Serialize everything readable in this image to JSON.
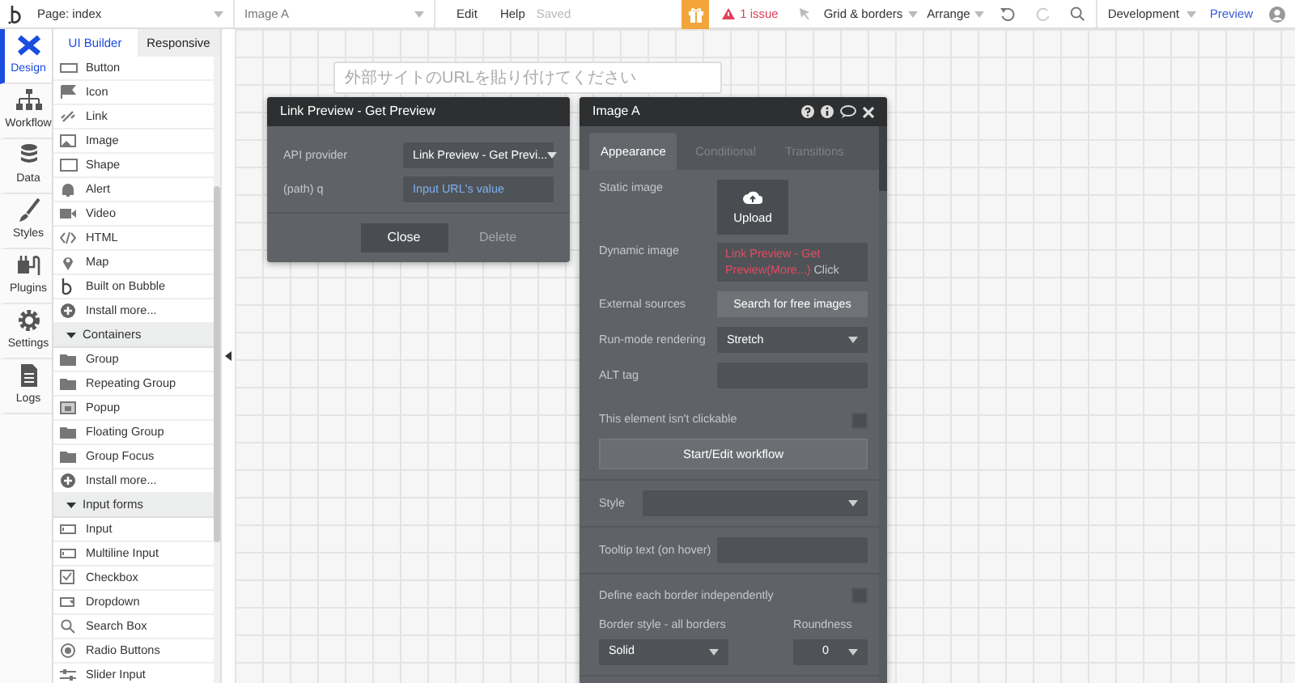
{
  "top_bar": {
    "page_select": "Page: index",
    "element_select": "Image A",
    "menu": [
      "Edit",
      "Help"
    ],
    "save_status": "Saved",
    "issues": "1 issue",
    "grid_menu": "Grid & borders",
    "arrange_menu": "Arrange",
    "mode_select": "Development",
    "preview": "Preview"
  },
  "nav_rail": [
    {
      "label": "Design",
      "selected": true
    },
    {
      "label": "Workflow",
      "selected": false
    },
    {
      "label": "Data",
      "selected": false
    },
    {
      "label": "Styles",
      "selected": false
    },
    {
      "label": "Plugins",
      "selected": false
    },
    {
      "label": "Settings",
      "selected": false
    },
    {
      "label": "Logs",
      "selected": false
    }
  ],
  "palette": {
    "tabs": [
      {
        "label": "UI Builder",
        "selected": true
      },
      {
        "label": "Responsive",
        "selected": false
      }
    ],
    "items": [
      {
        "kind": "item",
        "label": "Button"
      },
      {
        "kind": "item",
        "label": "Icon"
      },
      {
        "kind": "item",
        "label": "Link"
      },
      {
        "kind": "item",
        "label": "Image"
      },
      {
        "kind": "item",
        "label": "Shape"
      },
      {
        "kind": "item",
        "label": "Alert"
      },
      {
        "kind": "item",
        "label": "Video"
      },
      {
        "kind": "item",
        "label": "HTML"
      },
      {
        "kind": "item",
        "label": "Map"
      },
      {
        "kind": "item",
        "label": "Built on Bubble"
      },
      {
        "kind": "item",
        "label": "Install more..."
      },
      {
        "kind": "section",
        "label": "Containers",
        "expanded": true
      },
      {
        "kind": "item",
        "label": "Group"
      },
      {
        "kind": "item",
        "label": "Repeating Group"
      },
      {
        "kind": "item",
        "label": "Popup"
      },
      {
        "kind": "item",
        "label": "Floating Group"
      },
      {
        "kind": "item",
        "label": "Group Focus"
      },
      {
        "kind": "item",
        "label": "Install more..."
      },
      {
        "kind": "section",
        "label": "Input forms",
        "expanded": true
      },
      {
        "kind": "item",
        "label": "Input"
      },
      {
        "kind": "item",
        "label": "Multiline Input"
      },
      {
        "kind": "item",
        "label": "Checkbox"
      },
      {
        "kind": "item",
        "label": "Dropdown"
      },
      {
        "kind": "item",
        "label": "Search Box"
      },
      {
        "kind": "item",
        "label": "Radio Buttons"
      },
      {
        "kind": "item",
        "label": "Slider Input"
      }
    ]
  },
  "canvas": {
    "input_placeholder": "外部サイトのURLを貼り付けてください"
  },
  "api_popup": {
    "title": "Link Preview - Get Preview",
    "rows": [
      {
        "label": "API provider",
        "kind": "select",
        "value": "Link Preview - Get Previ..."
      },
      {
        "label": "(path) q",
        "kind": "expression",
        "value": "Input URL's value"
      }
    ],
    "buttons": [
      {
        "label": "Close",
        "disabled": false
      },
      {
        "label": "Delete",
        "disabled": true
      }
    ]
  },
  "property_editor": {
    "title": "Image A",
    "tabs": [
      {
        "label": "Appearance",
        "selected": true
      },
      {
        "label": "Conditional",
        "selected": false
      },
      {
        "label": "Transitions",
        "selected": false
      }
    ],
    "sections": [
      [
        {
          "kind": "upload",
          "label": "Static image",
          "button": "Upload"
        },
        {
          "kind": "dynamic",
          "label": "Dynamic image",
          "expression": "Link Preview - Get Preview(More...)",
          "hint": "Click"
        },
        {
          "kind": "button",
          "label": "External sources",
          "button": "Search for free images"
        },
        {
          "kind": "select",
          "label": "Run-mode rendering",
          "value": "Stretch"
        },
        {
          "kind": "field",
          "label": "ALT tag"
        }
      ],
      [
        {
          "kind": "checkbox",
          "label": "This element isn't clickable",
          "checked": false
        },
        {
          "kind": "wide_button",
          "button": "Start/Edit workflow"
        }
      ],
      [
        {
          "kind": "wide_select",
          "label": "Style"
        }
      ],
      [
        {
          "kind": "field",
          "label": "Tooltip text (on hover)"
        }
      ],
      [
        {
          "kind": "checkbox",
          "label": "Define each border independently",
          "checked": false
        },
        {
          "kind": "pair",
          "items": [
            {
              "label": "Border style - all borders",
              "value": "Solid"
            },
            {
              "label": "Roundness",
              "value": "0"
            }
          ]
        }
      ]
    ]
  }
}
